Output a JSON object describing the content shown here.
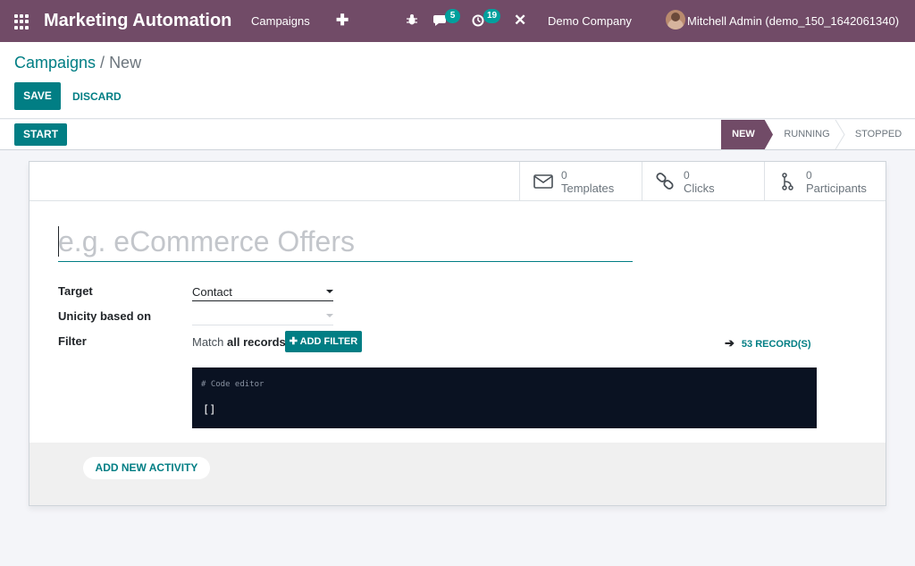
{
  "navbar": {
    "app_title": "Marketing Automation",
    "menu_campaigns": "Campaigns",
    "plus_glyph": "✚",
    "bug_glyph": "✱",
    "chat_badge": "5",
    "activity_badge": "19",
    "tools_glyph": "✕",
    "company": "Demo Company",
    "user": "Mitchell Admin (demo_150_1642061340)"
  },
  "breadcrumb": {
    "parent": "Campaigns",
    "separator": " / ",
    "current": "New"
  },
  "actions": {
    "save": "SAVE",
    "discard": "DISCARD"
  },
  "statusbar": {
    "start": "START",
    "stages": {
      "new": "NEW",
      "running": "RUNNING",
      "stopped": "STOPPED"
    },
    "active_stage": "new"
  },
  "smart_buttons": {
    "templates": {
      "count": "0",
      "label": "Templates"
    },
    "clicks": {
      "count": "0",
      "label": "Clicks"
    },
    "participants": {
      "count": "0",
      "label": "Participants"
    }
  },
  "form": {
    "name_placeholder": "e.g. eCommerce Offers",
    "target_label": "Target",
    "target_value": "Contact",
    "unicity_label": "Unicity based on",
    "unicity_value": "",
    "filter_label": "Filter",
    "match_prefix": "Match ",
    "match_all": "all records",
    "add_filter": "ADD FILTER",
    "add_filter_glyph": "✚ ",
    "records": "53 RECORD(S)",
    "records_arrow": "➔",
    "code_comment": "# Code editor",
    "code_value": "[]"
  },
  "activity": {
    "add_new": "ADD NEW ACTIVITY"
  },
  "colors": {
    "brand": "#714b67",
    "accent": "#017e84",
    "badge": "#00a09d",
    "code_bg": "#0a1222"
  }
}
